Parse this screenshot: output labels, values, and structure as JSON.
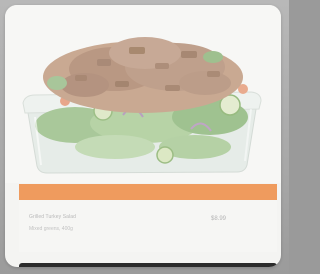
{
  "product": {
    "image_label": "salad-in-container-photo",
    "name": "Grilled Turkey Salad",
    "meta": "Mixed greens, 400g",
    "price": "$8.99"
  },
  "colors": {
    "accent": "#ef9b5e",
    "card_background": "#f4f4f2",
    "bottom_strip": "#2b2b2b"
  }
}
